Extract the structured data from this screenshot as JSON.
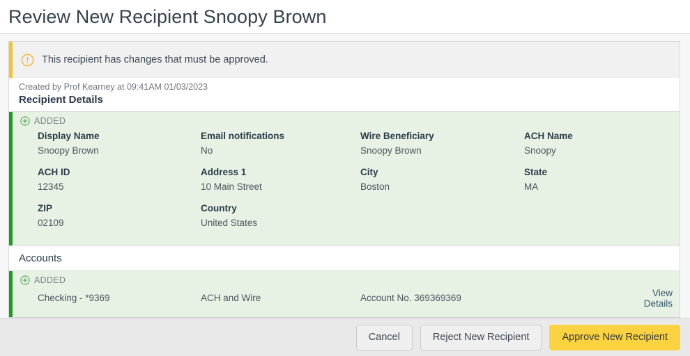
{
  "header": {
    "title": "Review New Recipient Snoopy Brown"
  },
  "alert": {
    "icon": "warning-circle-icon",
    "message": "This recipient has changes that must be approved.",
    "accent_color": "#f5c431"
  },
  "meta": {
    "created_line": "Created by Prof Kearney at 09:41AM 01/03/2023"
  },
  "recipient_details": {
    "section_title": "Recipient Details",
    "status_badge": {
      "icon": "plus-circle-icon",
      "label": "ADDED",
      "accent_color": "#1a9e1a"
    },
    "fields": [
      {
        "label": "Display Name",
        "value": "Snoopy Brown"
      },
      {
        "label": "Email notifications",
        "value": "No"
      },
      {
        "label": "Wire Beneficiary",
        "value": "Snoopy Brown"
      },
      {
        "label": "ACH Name",
        "value": "Snoopy"
      },
      {
        "label": "ACH ID",
        "value": "12345"
      },
      {
        "label": "Address 1",
        "value": "10 Main Street"
      },
      {
        "label": "City",
        "value": "Boston"
      },
      {
        "label": "State",
        "value": "MA"
      },
      {
        "label": "ZIP",
        "value": "02109"
      },
      {
        "label": "Country",
        "value": "United States"
      }
    ]
  },
  "accounts": {
    "section_title": "Accounts",
    "status_badge": {
      "icon": "plus-circle-icon",
      "label": "ADDED",
      "accent_color": "#1a9e1a"
    },
    "rows": [
      {
        "account_name": "Checking - *9369",
        "services": "ACH and Wire",
        "account_number": "Account No. 369369369",
        "details_link": "View Details"
      }
    ]
  },
  "footer": {
    "cancel_label": "Cancel",
    "reject_label": "Reject New Recipient",
    "approve_label": "Approve New Recipient",
    "approve_color": "#fbd341"
  }
}
